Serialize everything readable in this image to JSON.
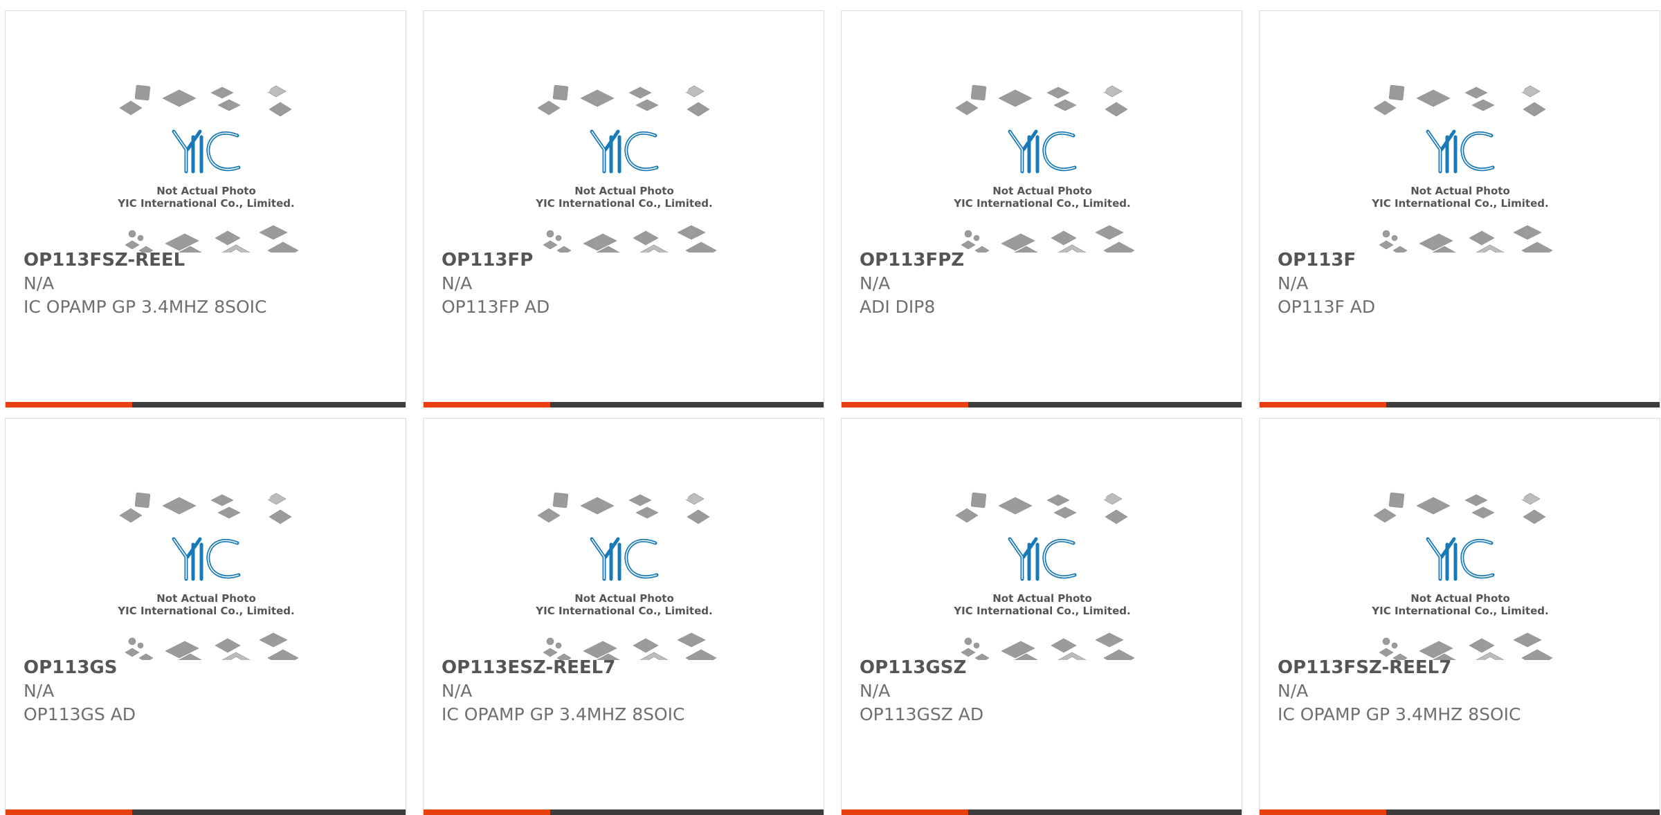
{
  "colors": {
    "accent_bar": "#e8400f",
    "dark_bar": "#3d3d3d",
    "part_text": "#555555",
    "sub_text": "#6f6f6f",
    "logo_blue": "#1a7ab8",
    "chip_gray": "#9b9b9b"
  },
  "watermark": {
    "logo_text": "YIC",
    "line1": "Not Actual Photo",
    "line2": "YIC International Co., Limited."
  },
  "products": [
    {
      "part": "OP113FSZ-REEL",
      "manufacturer": "N/A",
      "description": "IC OPAMP GP 3.4MHZ 8SOIC"
    },
    {
      "part": "OP113FP",
      "manufacturer": "N/A",
      "description": "OP113FP AD"
    },
    {
      "part": "OP113FPZ",
      "manufacturer": "N/A",
      "description": "ADI DIP8"
    },
    {
      "part": "OP113F",
      "manufacturer": "N/A",
      "description": "OP113F AD"
    },
    {
      "part": "OP113GS",
      "manufacturer": "N/A",
      "description": "OP113GS AD"
    },
    {
      "part": "OP113ESZ-REEL7",
      "manufacturer": "N/A",
      "description": "IC OPAMP GP 3.4MHZ 8SOIC"
    },
    {
      "part": "OP113GSZ",
      "manufacturer": "N/A",
      "description": "OP113GSZ AD"
    },
    {
      "part": "OP113FSZ-REEL7",
      "manufacturer": "N/A",
      "description": "IC OPAMP GP 3.4MHZ 8SOIC"
    }
  ]
}
